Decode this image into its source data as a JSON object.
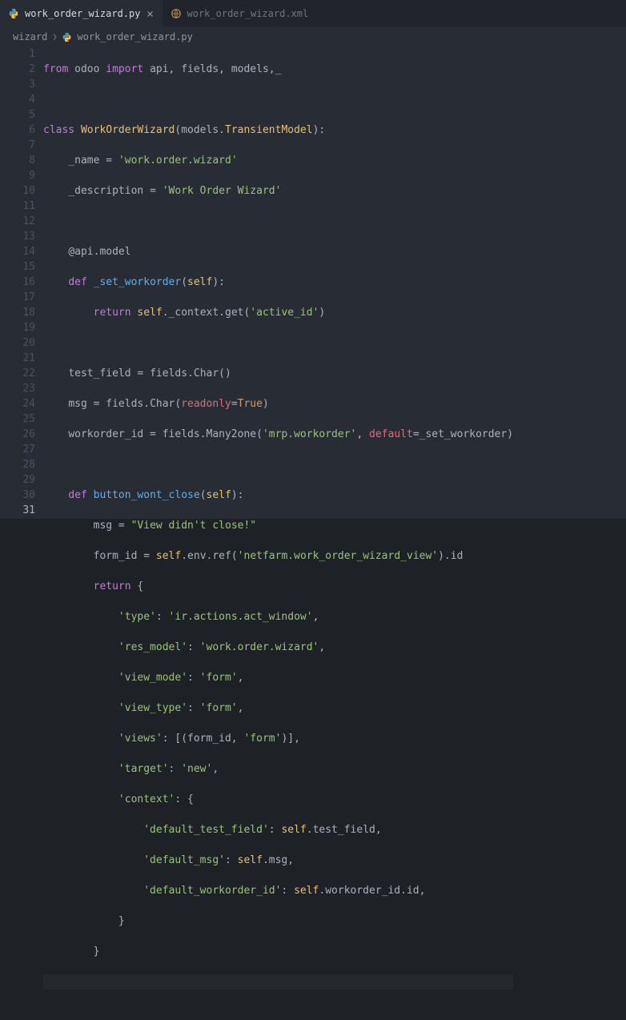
{
  "tabs": [
    {
      "label": "work_order_wizard.py",
      "active": true,
      "icon": "python"
    },
    {
      "label": "work_order_wizard.xml",
      "active": false,
      "icon": "xml"
    }
  ],
  "breadcrumb": {
    "folder": "wizard",
    "file": "work_order_wizard.py"
  },
  "current_line": 31,
  "code": {
    "l1": {
      "from": "from",
      "mod": "odoo",
      "import": "import",
      "names": "api, fields, models,_"
    },
    "l3": {
      "class": "class",
      "name": "WorkOrderWizard",
      "base_mod": "models",
      "base_cls": "TransientModel"
    },
    "l4": {
      "attr": "_name",
      "val": "'work.order.wizard'"
    },
    "l5": {
      "attr": "_description",
      "val": "'Work Order Wizard'"
    },
    "l7": {
      "deco": "@api.model"
    },
    "l8": {
      "def": "def",
      "fn": "_set_workorder",
      "self": "self"
    },
    "l9": {
      "return": "return",
      "self": "self",
      "rest": "._context.get(",
      "str": "'active_id'",
      "close": ")"
    },
    "l11": {
      "name": "test_field",
      "eq": " = ",
      "rhs": "fields.Char()"
    },
    "l12": {
      "name": "msg",
      "eq": " = ",
      "rhs1": "fields.Char(",
      "kw": "readonly",
      "eqs": "=",
      "val": "True",
      "close": ")"
    },
    "l13": {
      "name": "workorder_id",
      "eq": " = ",
      "rhs1": "fields.Many2one(",
      "str": "'mrp.workorder'",
      "comma": ", ",
      "kw": "default",
      "eqs": "=",
      "val": "_set_workorder)"
    },
    "l15": {
      "def": "def",
      "fn": "button_wont_close",
      "self": "self"
    },
    "l16": {
      "name": "msg",
      "eq": " = ",
      "str": "\"View didn't close!\""
    },
    "l17": {
      "name": "form_id",
      "eq": " = ",
      "self": "self",
      "chain": ".env.ref(",
      "str": "'netfarm.work_order_wizard_view'",
      "close": ").id"
    },
    "l18": {
      "return": "return",
      "brace": " {"
    },
    "l19": {
      "key": "'type'",
      "val": "'ir.actions.act_window'",
      "end": ","
    },
    "l20": {
      "key": "'res_model'",
      "val": "'work.order.wizard'",
      "end": ","
    },
    "l21": {
      "key": "'view_mode'",
      "val": "'form'",
      "end": ","
    },
    "l22": {
      "key": "'view_type'",
      "val": "'form'",
      "end": ","
    },
    "l23": {
      "key": "'views'",
      "mid": ": [(form_id, ",
      "val": "'form'",
      "end": ")],"
    },
    "l24": {
      "key": "'target'",
      "val": "'new'",
      "end": ","
    },
    "l25": {
      "key": "'context'",
      "end": ": {"
    },
    "l26": {
      "key": "'default_test_field'",
      "self": "self",
      "rest": ".test_field,"
    },
    "l27": {
      "key": "'default_msg'",
      "self": "self",
      "rest": ".msg,"
    },
    "l28": {
      "key": "'default_workorder_id'",
      "self": "self",
      "rest": ".workorder_id.id,"
    },
    "l29": {
      "brace": "}"
    },
    "l30": {
      "brace": "}"
    }
  }
}
